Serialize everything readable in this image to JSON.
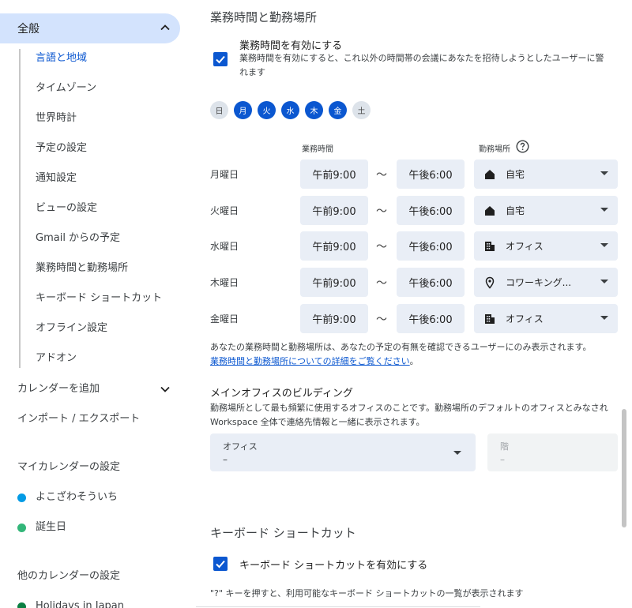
{
  "sidebar": {
    "section_label": "全般",
    "items": [
      {
        "label": "言語と地域",
        "active": true
      },
      {
        "label": "タイムゾーン"
      },
      {
        "label": "世界時計"
      },
      {
        "label": "予定の設定"
      },
      {
        "label": "通知設定"
      },
      {
        "label": "ビューの設定"
      },
      {
        "label": "Gmail からの予定"
      },
      {
        "label": "業務時間と勤務場所"
      },
      {
        "label": "キーボード ショートカット"
      },
      {
        "label": "オフライン設定"
      },
      {
        "label": "アドオン"
      }
    ],
    "add_calendar": "カレンダーを追加",
    "import_export": "インポート / エクスポート",
    "my_calendars_heading": "マイカレンダーの設定",
    "my_calendars": [
      {
        "label": "よこざわそういち",
        "color": "#039be5"
      },
      {
        "label": "誕生日",
        "color": "#33b679"
      }
    ],
    "other_calendars_heading": "他のカレンダーの設定",
    "other_calendars": [
      {
        "label": "Holidays in Japan",
        "color": "#0b8043"
      }
    ]
  },
  "working_hours": {
    "title": "業務時間と勤務場所",
    "enable_label": "業務時間を有効にする",
    "enable_desc_1": "業務時間を有効にすると、これ以外の時間帯の会議にあなたを招待しようとしたユーザーに警",
    "enable_desc_2": "れます",
    "days": [
      {
        "label": "日",
        "on": false
      },
      {
        "label": "月",
        "on": true
      },
      {
        "label": "火",
        "on": true
      },
      {
        "label": "水",
        "on": true
      },
      {
        "label": "木",
        "on": true
      },
      {
        "label": "金",
        "on": true
      },
      {
        "label": "土",
        "on": false
      }
    ],
    "col_hours": "業務時間",
    "col_location": "勤務場所",
    "tilde": "〜",
    "rows": [
      {
        "day": "月曜日",
        "start": "午前9:00",
        "end": "午後6:00",
        "location": "自宅",
        "icon": "home-icon"
      },
      {
        "day": "火曜日",
        "start": "午前9:00",
        "end": "午後6:00",
        "location": "自宅",
        "icon": "home-icon"
      },
      {
        "day": "水曜日",
        "start": "午前9:00",
        "end": "午後6:00",
        "location": "オフィス",
        "icon": "building-icon"
      },
      {
        "day": "木曜日",
        "start": "午前9:00",
        "end": "午後6:00",
        "location": "コワーキング...",
        "icon": "location-pin-icon"
      },
      {
        "day": "金曜日",
        "start": "午前9:00",
        "end": "午後6:00",
        "location": "オフィス",
        "icon": "building-icon"
      }
    ],
    "visibility_note": "あなたの業務時間と勤務場所は、あなたの予定の有無を確認できるユーザーにのみ表示されます。",
    "learn_more_link": "業務時間と勤務場所についての詳細をご覧ください",
    "period": "。"
  },
  "main_office": {
    "title": "メインオフィスのビルディング",
    "desc_1": "勤務場所として最も頻繁に使用するオフィスのことです。勤務場所のデフォルトのオフィスとみなされ",
    "desc_2": "Workspace 全体で連絡先情報と一緒に表示されます。",
    "office_label": "オフィス",
    "office_value": "–",
    "floor_label": "階",
    "floor_value": "–"
  },
  "shortcuts": {
    "title": "キーボード ショートカット",
    "enable_label": "キーボード ショートカットを有効にする",
    "desc": "\"?\" キーを押すと、利用可能なキーボード ショートカットの一覧が表示されます"
  }
}
